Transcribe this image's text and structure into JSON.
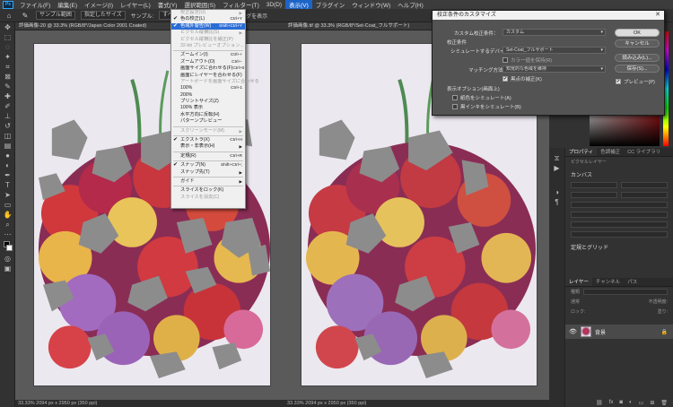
{
  "app": {
    "logo": "Ps"
  },
  "menubar": {
    "items": [
      "ファイル(F)",
      "編集(E)",
      "イメージ(I)",
      "レイヤー(L)",
      "書式(Y)",
      "選択範囲(S)",
      "フィルター(T)",
      "3D(D)",
      "表示(V)",
      "プラグイン",
      "ウィンドウ(W)",
      "ヘルプ(H)"
    ],
    "active_index": 8
  },
  "options": {
    "sample_size": "サンプル範囲",
    "sample_value": "指定したサイズ",
    "sample_label": "サンプル:",
    "sample_layers": "すべてのレイヤー",
    "show_ring": "サンプルリングを表示"
  },
  "documents": [
    {
      "title": "評価画像-20 @ 33.3% (RGB/8*/Japan Color 2001 Coated)",
      "status": "33.33%  2094 px x 2950 px (350 ppi)"
    },
    {
      "title": "評価画像.tif @ 33.3% (RGB/8*/Set-Coat_フルサポート)",
      "status": "33.33%  2094 px x 2950 px (350 ppi)"
    }
  ],
  "view_menu": {
    "items": [
      {
        "label": "校正設定(U)",
        "shortcut": "",
        "arrow": true,
        "disabled": true,
        "checked": false
      },
      {
        "label": "色の校正(L)",
        "shortcut": "Ctrl+Y",
        "checked": true
      },
      {
        "label": "色域外警告(W)",
        "shortcut": "Shift+Ctrl+Y",
        "checked": true,
        "highlight": true
      },
      {
        "label": "ピクセル縦横比(S)",
        "shortcut": "",
        "arrow": true,
        "disabled": true
      },
      {
        "label": "ピクセル縦横比を補正(P)",
        "shortcut": "",
        "disabled": true
      },
      {
        "label": "32-bit プレビューオプション...",
        "shortcut": "",
        "disabled": true
      },
      {
        "sep": true
      },
      {
        "label": "ズームイン(I)",
        "shortcut": "Ctrl++"
      },
      {
        "label": "ズームアウト(O)",
        "shortcut": "Ctrl+-"
      },
      {
        "label": "画面サイズに合わせる(F)",
        "shortcut": "Ctrl+0"
      },
      {
        "label": "画面にレイヤーを合わせる(F)",
        "shortcut": ""
      },
      {
        "label": "アートボードを画面サイズに合わせる",
        "shortcut": "",
        "disabled": true
      },
      {
        "label": "100%",
        "shortcut": "Ctrl+1"
      },
      {
        "label": "200%",
        "shortcut": ""
      },
      {
        "label": "プリントサイズ(Z)",
        "shortcut": ""
      },
      {
        "label": "100% 表示",
        "shortcut": ""
      },
      {
        "label": "水平方向に反転(H)",
        "shortcut": ""
      },
      {
        "label": "パターンプレビュー",
        "shortcut": ""
      },
      {
        "sep": true
      },
      {
        "label": "スクリーンモード(M)",
        "shortcut": "",
        "arrow": true,
        "disabled": true
      },
      {
        "sep": true
      },
      {
        "label": "エクストラ(X)",
        "shortcut": "Ctrl+H",
        "checked": true
      },
      {
        "label": "表示・非表示(H)",
        "shortcut": "",
        "arrow": true
      },
      {
        "sep": true
      },
      {
        "label": "定規(R)",
        "shortcut": "Ctrl+R"
      },
      {
        "sep": true
      },
      {
        "label": "スナップ(N)",
        "shortcut": "Shift+Ctrl+;",
        "checked": true
      },
      {
        "label": "スナップ先(T)",
        "shortcut": "",
        "arrow": true
      },
      {
        "sep": true
      },
      {
        "label": "ガイド",
        "shortcut": "",
        "arrow": true
      },
      {
        "sep": true
      },
      {
        "label": "スライスをロック(K)",
        "shortcut": ""
      },
      {
        "label": "スライスを消去(C)",
        "shortcut": "",
        "disabled": true
      }
    ]
  },
  "dialog": {
    "title": "校正条件のカスタマイズ",
    "custom_label": "カスタム校正条件：",
    "custom_value": "カスタム",
    "proof_header": "校正条件",
    "device_label": "シミュレートするデバイス：",
    "device_value": "Set-Coat_フルサポート",
    "preserve_label": "カラー値を保持(R)",
    "intent_label": "マッチング方法：",
    "intent_value": "知覚的な色域を維持",
    "bpc_label": "黒点の補正(K)",
    "display_header": "表示オプション(画面上)",
    "paper_label": "紙色をシミュレート(A)",
    "ink_label": "黒インキをシミュレート(B)",
    "ok": "OK",
    "cancel": "キャンセル",
    "load": "読み込み(L)...",
    "save": "保存(S)...",
    "preview": "プレビュー(P)",
    "close": "✕"
  },
  "properties": {
    "tabs": [
      "プロパティ",
      "色調補正",
      "CC ライブラリ"
    ],
    "layer_type": "ピクセルレイヤー",
    "canvas_title": "カンバス",
    "rulers_title": "定規とグリッド"
  },
  "layers": {
    "tabs": [
      "レイヤー",
      "チャンネル",
      "パス"
    ],
    "kind": "種類",
    "blend": "通常",
    "opacity_label": "不透明度:",
    "lock_label": "ロック:",
    "fill_label": "塗り:",
    "layer_name": "背景"
  },
  "colors": {
    "menu_highlight": "#1d64c8",
    "gamut_gray": "#8c8c8c",
    "ui_dark": "#323232"
  }
}
